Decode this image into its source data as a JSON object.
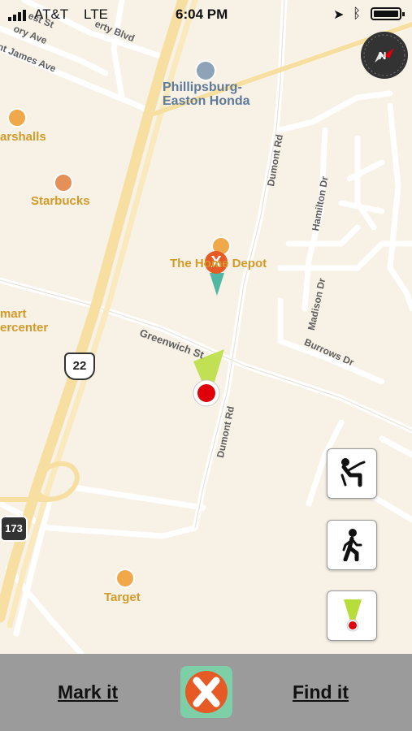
{
  "status_bar": {
    "carrier": "AT&T",
    "network": "LTE",
    "time": "6:04 PM"
  },
  "map": {
    "pois": {
      "phillipsburg_honda_line1": "Phillipsburg-",
      "phillipsburg_honda_line2": "Easton Honda",
      "marshalls": "arshalls",
      "starbucks": "Starbucks",
      "home_depot": "The Home Depot",
      "walmart_line1": "mart",
      "walmart_line2": "ercenter",
      "target": "Target"
    },
    "streets": {
      "liberty_blvd": "erty Blvd",
      "st_james_ave": "nt James Ave",
      "victory_ave": "ory Ave",
      "west_st": "est St",
      "dumont_rd_top": "Dumont Rd",
      "hamilton_dr": "Hamilton Dr",
      "madison_dr": "Madison Dr",
      "burrows_dr": "Burrows Dr",
      "greenwich_st": "Greenwich St",
      "dumont_rd_bottom": "Dumont Rd"
    },
    "shields": {
      "route_22": "22",
      "route_173": "173"
    },
    "compass_icon": "compass-icon",
    "colors": {
      "background": "#f7f1e6",
      "highway": "#f6dfa0",
      "poi": "#d49a28",
      "marker_red": "#e0000a",
      "beam_green": "#b7dd3a",
      "pin_teal": "#4fb7a3"
    }
  },
  "side_buttons": [
    {
      "icon": "sit-person-icon"
    },
    {
      "icon": "walking-person-icon"
    },
    {
      "icon": "marker-beam-icon"
    }
  ],
  "bottom_bar": {
    "mark_label": "Mark it",
    "find_label": "Find it",
    "logo_icon": "app-logo-x-icon"
  }
}
